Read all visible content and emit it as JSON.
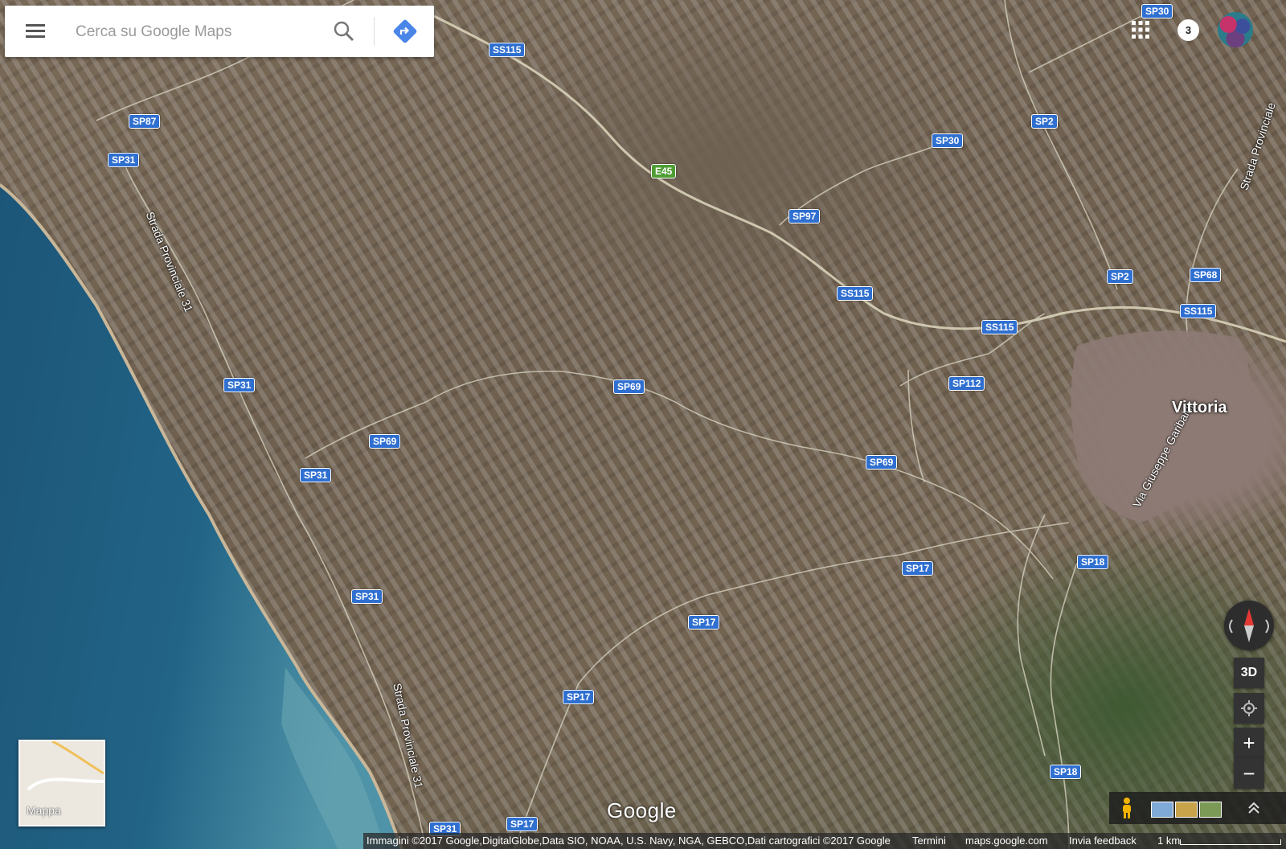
{
  "search": {
    "placeholder": "Cerca su Google Maps"
  },
  "header": {
    "notification_count": "3"
  },
  "map": {
    "road_shields": [
      {
        "label": "SS115",
        "style": "blue"
      },
      {
        "label": "SP87",
        "style": "blue"
      },
      {
        "label": "SP31",
        "style": "blue"
      },
      {
        "label": "E45",
        "style": "green"
      },
      {
        "label": "SP97",
        "style": "blue"
      },
      {
        "label": "SP30",
        "style": "blue"
      },
      {
        "label": "SP2",
        "style": "blue"
      },
      {
        "label": "SP30",
        "style": "blue"
      },
      {
        "label": "SS115",
        "style": "blue"
      },
      {
        "label": "SS115",
        "style": "blue"
      },
      {
        "label": "SP2",
        "style": "blue"
      },
      {
        "label": "SP68",
        "style": "blue"
      },
      {
        "label": "SS115",
        "style": "blue"
      },
      {
        "label": "SP31",
        "style": "blue"
      },
      {
        "label": "SP69",
        "style": "blue"
      },
      {
        "label": "SP112",
        "style": "blue"
      },
      {
        "label": "SP69",
        "style": "blue"
      },
      {
        "label": "SP31",
        "style": "blue"
      },
      {
        "label": "SP69",
        "style": "blue"
      },
      {
        "label": "SP18",
        "style": "blue"
      },
      {
        "label": "SP17",
        "style": "blue"
      },
      {
        "label": "SP31",
        "style": "blue"
      },
      {
        "label": "SP17",
        "style": "blue"
      },
      {
        "label": "SP17",
        "style": "blue"
      },
      {
        "label": "SP18",
        "style": "blue"
      },
      {
        "label": "SP17",
        "style": "blue"
      },
      {
        "label": "SP31",
        "style": "blue"
      }
    ],
    "road_names": [
      "Strada Provinciale 31",
      "Strada Provinciale 31",
      "Via Giuseppe Garibaldi",
      "Strada Provinciale"
    ],
    "town": "Vittoria"
  },
  "minimap": {
    "label": "Mappa"
  },
  "controls": {
    "three_d": "3D",
    "zoom_in": "+",
    "zoom_out": "−"
  },
  "logo": "Google",
  "footer": {
    "attribution": "Immagini ©2017 Google,DigitalGlobe,Data SIO, NOAA, U.S. Navy, NGA, GEBCO,Dati cartografici ©2017 Google",
    "terms": "Termini",
    "site": "maps.google.com",
    "feedback": "Invia feedback",
    "scale": "1 km"
  },
  "colors": {
    "shield": "#2f6fd0",
    "shield_green": "#4f9d35",
    "sea_deep": "#1f5b7c",
    "sea_shallow": "#4f93a8"
  }
}
